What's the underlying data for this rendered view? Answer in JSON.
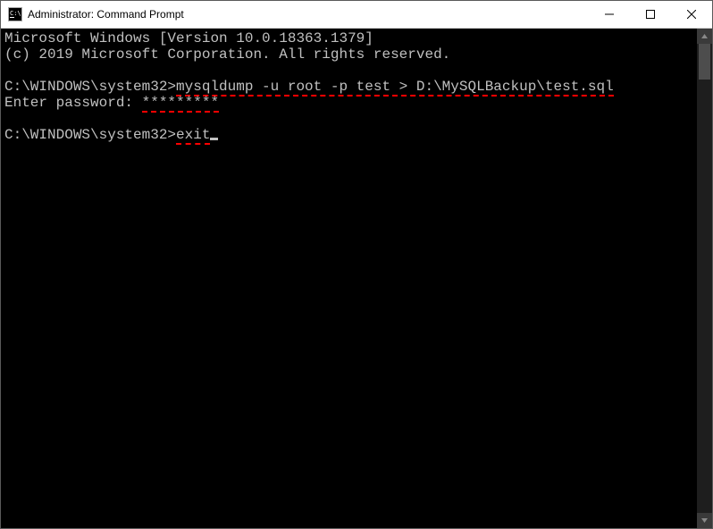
{
  "window": {
    "title": "Administrator: Command Prompt",
    "icons": {
      "app": "cmd-icon",
      "minimize": "minimize-icon",
      "maximize": "maximize-icon",
      "close": "close-icon"
    }
  },
  "terminal": {
    "lines": {
      "banner1": "Microsoft Windows [Version 10.0.18363.1379]",
      "banner2": "(c) 2019 Microsoft Corporation. All rights reserved.",
      "prompt1_path": "C:\\WINDOWS\\system32>",
      "cmd1": "mysqldump -u root -p test > D:\\MySQLBackup\\test.sql",
      "enter_pw_label": "Enter password: ",
      "pw_mask": "*********",
      "prompt2_path": "C:\\WINDOWS\\system32>",
      "cmd2": "exit"
    }
  },
  "scrollbar": {
    "up": "▲",
    "down": "▼"
  }
}
